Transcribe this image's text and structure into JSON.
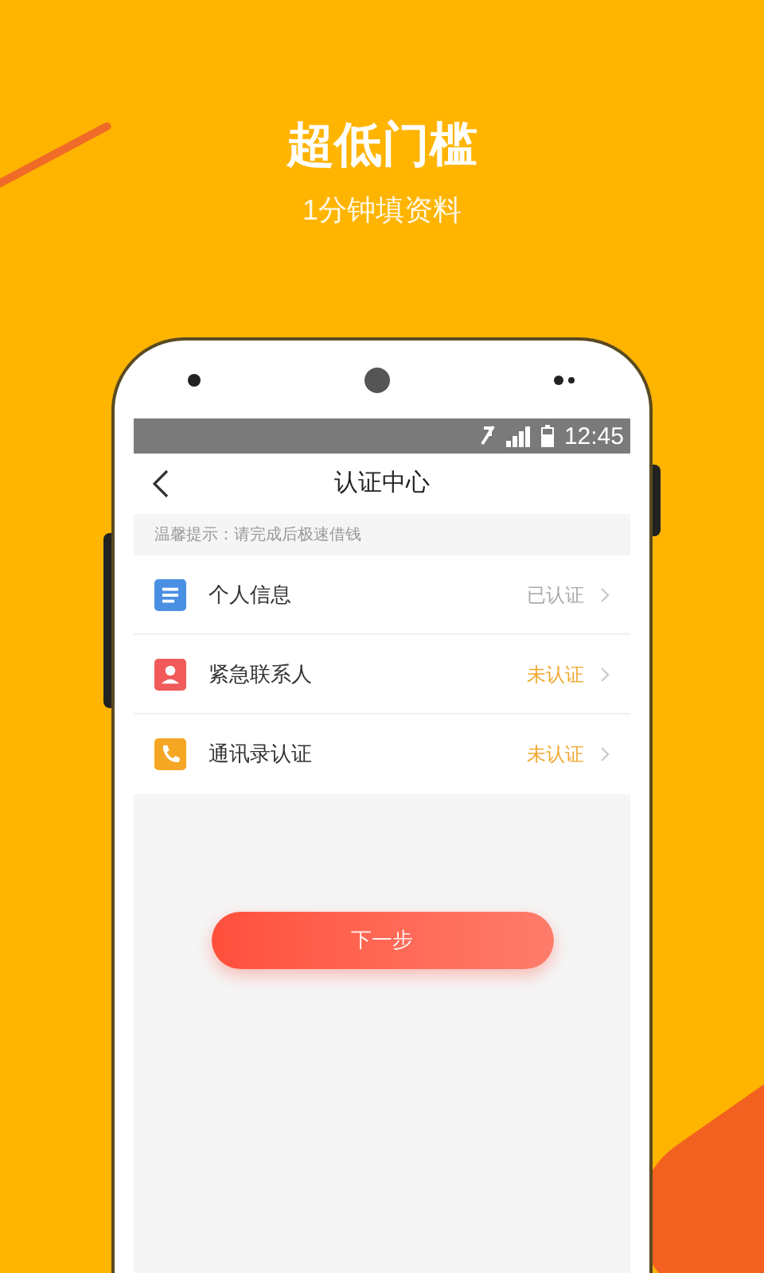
{
  "headline": "超低门槛",
  "subheadline": "1分钟填资料",
  "status_bar": {
    "time": "12:45"
  },
  "nav": {
    "title": "认证中心"
  },
  "notice": "温馨提示：请完成后极速借钱",
  "items": [
    {
      "kind": "document",
      "label": "个人信息",
      "status": "已认证",
      "verified": true,
      "color": "#4a90e2"
    },
    {
      "kind": "contact",
      "label": "紧急联系人",
      "status": "未认证",
      "verified": false,
      "color": "#f05a5a"
    },
    {
      "kind": "phone",
      "label": "通讯录认证",
      "status": "未认证",
      "verified": false,
      "color": "#f5a623"
    }
  ],
  "next_button": "下一步"
}
